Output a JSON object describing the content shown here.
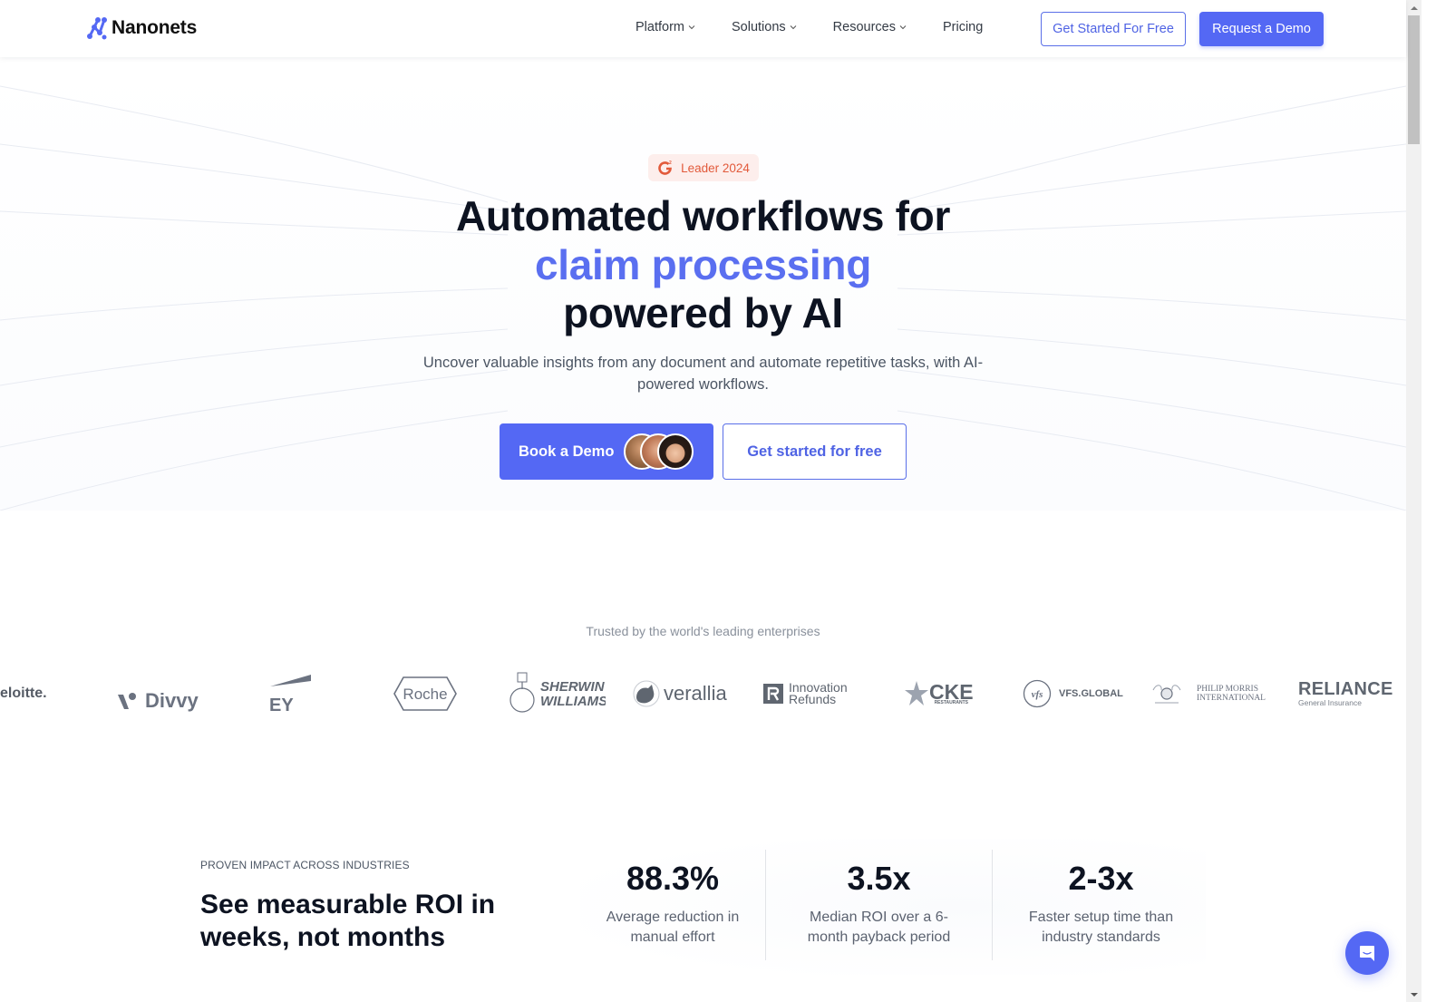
{
  "header": {
    "logo_text": "Nanonets",
    "nav": [
      {
        "label": "Platform",
        "has_dropdown": true
      },
      {
        "label": "Solutions",
        "has_dropdown": true
      },
      {
        "label": "Resources",
        "has_dropdown": true
      },
      {
        "label": "Pricing",
        "has_dropdown": false
      }
    ],
    "cta_secondary": "Get Started For Free",
    "cta_primary": "Request a Demo"
  },
  "hero": {
    "badge": {
      "icon": "g2-icon",
      "label": "Leader 2024"
    },
    "title_line1": "Automated workflows for",
    "title_accent": "claim processing",
    "title_line3": "powered by AI",
    "subtitle": "Uncover valuable insights from any document and automate repetitive tasks, with AI-powered workflows.",
    "book_demo_label": "Book a Demo",
    "get_started_label": "Get started for free"
  },
  "trusted": {
    "label": "Trusted by the world's leading enterprises",
    "logos": [
      {
        "name": "Deloitte",
        "text": "eloitte."
      },
      {
        "name": "Divvy",
        "text": "Divvy"
      },
      {
        "name": "EY",
        "text": "EY"
      },
      {
        "name": "Roche",
        "text": "Roche"
      },
      {
        "name": "Sherwin Williams",
        "text_line1": "SHERWIN",
        "text_line2": "WILLIAMS."
      },
      {
        "name": "Verallia",
        "text": "verallia"
      },
      {
        "name": "Innovation Refunds",
        "text_line1": "Innovation",
        "text_line2": "Refunds"
      },
      {
        "name": "CKE Restaurants",
        "text": "CKE",
        "sub": "RESTAURANTS"
      },
      {
        "name": "VFS Global",
        "text": "VFS.GLOBAL",
        "mark": "vfs"
      },
      {
        "name": "Philip Morris International",
        "text_line1": "PHILIP MORRIS",
        "text_line2": "INTERNATIONAL"
      },
      {
        "name": "Reliance General Insurance",
        "text": "RELIANCE",
        "sub": "General Insurance"
      }
    ]
  },
  "stats": {
    "eyebrow": "PROVEN IMPACT ACROSS INDUSTRIES",
    "heading": "See measurable ROI in weeks, not months",
    "items": [
      {
        "value": "88.3%",
        "description": "Average reduction in manual effort"
      },
      {
        "value": "3.5x",
        "description": "Median ROI over a 6-month payback period"
      },
      {
        "value": "2-3x",
        "description": "Faster setup time than industry standards"
      }
    ]
  },
  "chat": {
    "icon": "chat-icon"
  },
  "colors": {
    "brand": "#5468f4",
    "accent_text": "#5a6ff0",
    "badge_bg": "#fdeeec",
    "badge_text": "#e25a3b",
    "heading": "#0d1321"
  }
}
